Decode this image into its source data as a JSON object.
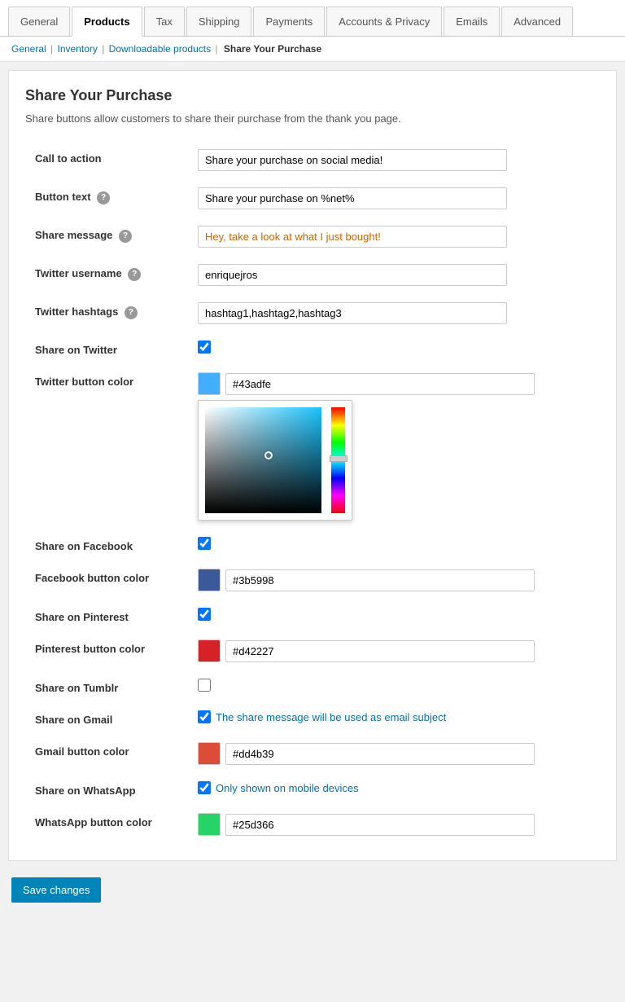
{
  "tabs": [
    {
      "id": "general",
      "label": "General",
      "active": false
    },
    {
      "id": "products",
      "label": "Products",
      "active": true
    },
    {
      "id": "tax",
      "label": "Tax",
      "active": false
    },
    {
      "id": "shipping",
      "label": "Shipping",
      "active": false
    },
    {
      "id": "payments",
      "label": "Payments",
      "active": false
    },
    {
      "id": "accounts-privacy",
      "label": "Accounts & Privacy",
      "active": false
    },
    {
      "id": "emails",
      "label": "Emails",
      "active": false
    },
    {
      "id": "advanced",
      "label": "Advanced",
      "active": false
    }
  ],
  "breadcrumb": {
    "general": "General",
    "inventory": "Inventory",
    "downloadable": "Downloadable products",
    "current": "Share Your Purchase"
  },
  "page": {
    "title": "Share Your Purchase",
    "description": "Share buttons allow customers to share their purchase from the thank you page."
  },
  "fields": {
    "call_to_action": {
      "label": "Call to action",
      "value": "Share your purchase on social media!"
    },
    "button_text": {
      "label": "Button text",
      "value": "Share your purchase on %net%"
    },
    "share_message": {
      "label": "Share message",
      "value": "Hey, take a look at what I just bought!"
    },
    "twitter_username": {
      "label": "Twitter username",
      "value": "enriquejros"
    },
    "twitter_hashtags": {
      "label": "Twitter hashtags",
      "value": "hashtag1,hashtag2,hashtag3"
    },
    "share_on_twitter": {
      "label": "Share on Twitter",
      "checked": true
    },
    "twitter_button_color": {
      "label": "Twitter button color",
      "color": "#43adfe",
      "swatch": "#43adfe"
    },
    "share_on_facebook": {
      "label": "Share on Facebook"
    },
    "facebook_button_color": {
      "label": "Facebook button color"
    },
    "share_on_pinterest": {
      "label": "Share on Pinterest"
    },
    "pinterest_button_color": {
      "label": "Pinterest button color",
      "color": "#d42227",
      "swatch": "#d42227"
    },
    "share_on_tumblr": {
      "label": "Share on Tumblr",
      "checked": false
    },
    "share_on_gmail": {
      "label": "Share on Gmail",
      "checked": true,
      "note": "The share message will be used as email subject"
    },
    "gmail_button_color": {
      "label": "Gmail button color",
      "color": "#dd4b39",
      "swatch": "#dd4b39"
    },
    "share_on_whatsapp": {
      "label": "Share on WhatsApp",
      "checked": true,
      "note": "Only shown on mobile devices"
    },
    "whatsapp_button_color": {
      "label": "WhatsApp button color",
      "color": "#25d366",
      "swatch": "#25d366"
    }
  },
  "buttons": {
    "save": "Save changes"
  }
}
